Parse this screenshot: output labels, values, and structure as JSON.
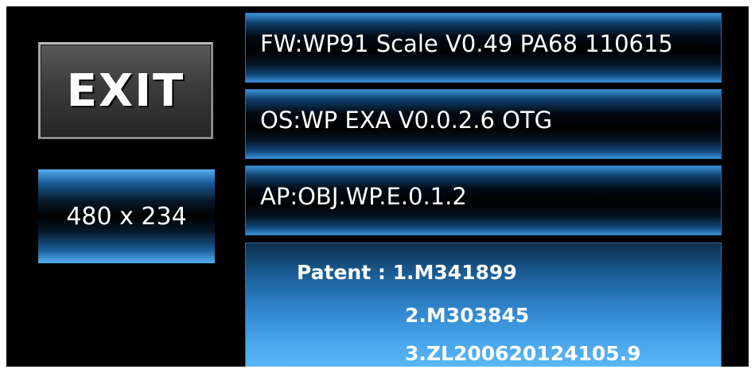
{
  "exit_button": {
    "label": "EXIT"
  },
  "resolution": {
    "text": "480 x 234"
  },
  "firmware": {
    "text": "FW:WP91 Scale V0.49 PA68 110615"
  },
  "os": {
    "text": "OS:WP EXA V0.0.2.6 OTG"
  },
  "app": {
    "text": "AP:OBJ.WP.E.0.1.2"
  },
  "patent": {
    "lines": [
      "Patent : 1.M341899",
      "2.M303845",
      "3.ZL200620124105.9"
    ]
  },
  "colors": {
    "background": "#000000",
    "accent_blue": "#3a92d8",
    "text": "#ffffff",
    "exit_button_face": "#3c3c3c"
  }
}
